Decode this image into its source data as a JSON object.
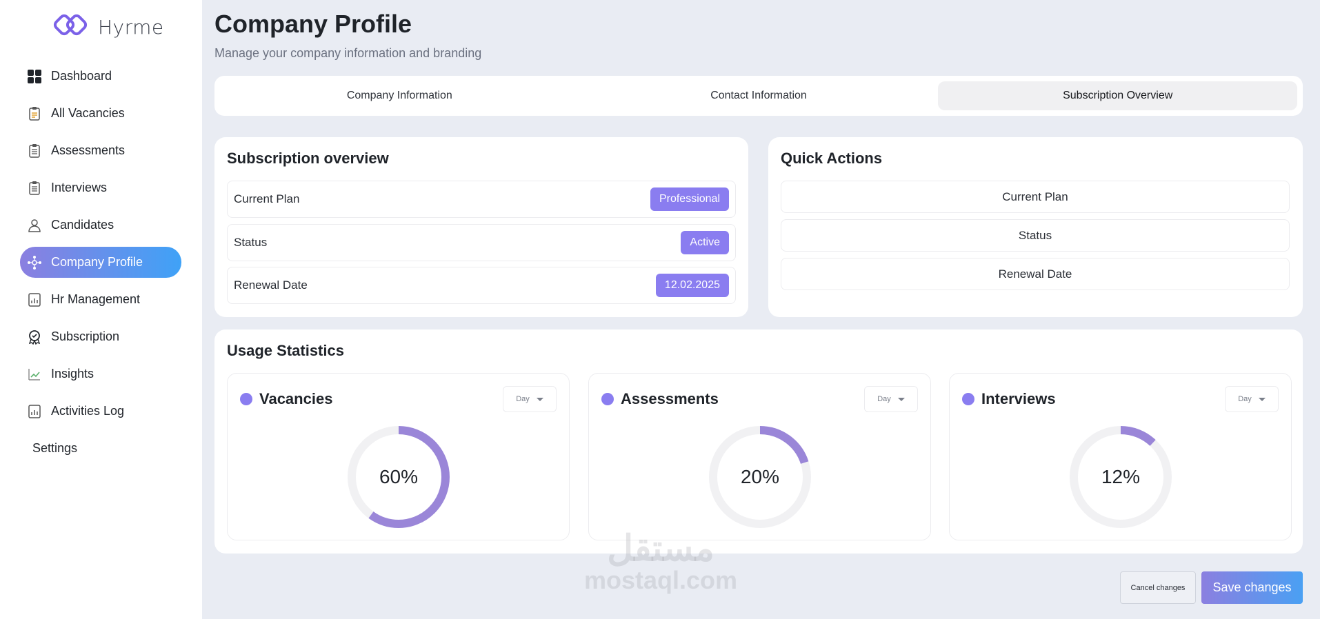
{
  "brand": {
    "name": "Hyrme"
  },
  "sidebar": {
    "items": [
      {
        "label": "Dashboard",
        "icon": "grid-icon"
      },
      {
        "label": "All Vacancies",
        "icon": "clipboard-icon"
      },
      {
        "label": "Assessments",
        "icon": "clipboard-list-icon"
      },
      {
        "label": "Interviews",
        "icon": "calendar-list-icon"
      },
      {
        "label": "Candidates",
        "icon": "user-icon"
      },
      {
        "label": "Company Profile",
        "icon": "network-icon",
        "active": true
      },
      {
        "label": "Hr Management",
        "icon": "report-icon"
      },
      {
        "label": "Subscription",
        "icon": "badge-icon"
      },
      {
        "label": "Insights",
        "icon": "chart-icon"
      },
      {
        "label": "Activities Log",
        "icon": "log-icon"
      },
      {
        "label": "Settings"
      }
    ]
  },
  "header": {
    "title": "Company Profile",
    "subtitle": "Manage your company information and branding"
  },
  "tabs": [
    {
      "label": "Company Information"
    },
    {
      "label": "Contact Information"
    },
    {
      "label": "Subscription Overview",
      "active": true
    }
  ],
  "subscription": {
    "title": "Subscription overview",
    "rows": [
      {
        "label": "Current Plan",
        "value": "Professional"
      },
      {
        "label": "Status",
        "value": "Active"
      },
      {
        "label": "Renewal Date",
        "value": "12.02.2025"
      }
    ]
  },
  "quick_actions": {
    "title": "Quick Actions",
    "buttons": [
      "Current Plan",
      "Status",
      "Renewal Date"
    ]
  },
  "usage": {
    "title": "Usage Statistics",
    "stats": [
      {
        "label": "Vacancies",
        "period": "Day",
        "percent_text": "60%",
        "value": 60,
        "color": "#9a86d8"
      },
      {
        "label": "Assessments",
        "period": "Day",
        "percent_text": "20%",
        "value": 20,
        "color": "#9a86d8"
      },
      {
        "label": "Interviews",
        "period": "Day",
        "percent_text": "12%",
        "value": 12,
        "color": "#9a86d8"
      }
    ]
  },
  "actions": {
    "cancel_label": "Cancel changes",
    "save_label": "Save changes"
  },
  "watermark": {
    "arabic": "مستقل",
    "latin": "mostaql.com"
  },
  "colors": {
    "accent": "#8a7df0",
    "gradient_end": "#3fa2f7",
    "background": "#e9ecf3"
  }
}
